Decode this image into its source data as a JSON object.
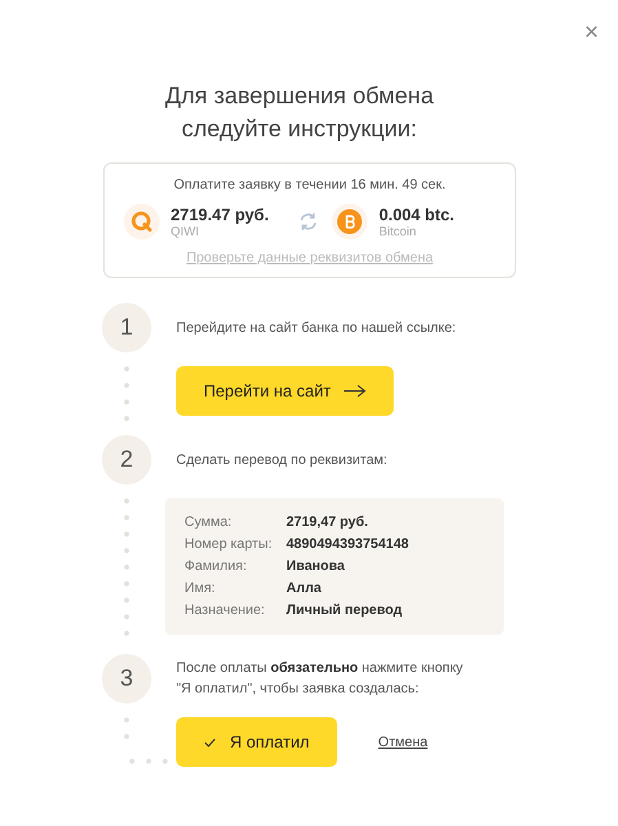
{
  "close": "×",
  "title": "Для завершения обмена\nследуйте инструкции:",
  "summary": {
    "timer": "Оплатите заявку в течении 16 мин. 49 сек.",
    "from": {
      "amount": "2719.47 руб.",
      "currency": "QIWI"
    },
    "to": {
      "amount": "0.004 btc.",
      "currency": "Bitcoin"
    },
    "link": "Проверьте данные реквизитов обмена"
  },
  "steps": [
    {
      "number": "1",
      "kind": "button",
      "text": "Перейдите на сайт банка по нашей ссылке:",
      "button": "Перейти на сайт"
    },
    {
      "number": "2",
      "kind": "details",
      "text": "Сделать перевод по реквизитам:",
      "details": [
        {
          "label": "Сумма:",
          "value": "2719,47 руб."
        },
        {
          "label": "Номер карты:",
          "value": "4890494393754148"
        },
        {
          "label": "Фамилия:",
          "value": "Иванова"
        },
        {
          "label": "Имя:",
          "value": "Алла"
        },
        {
          "label": "Назначение:",
          "value": "Личный перевод"
        }
      ]
    },
    {
      "number": "3",
      "kind": "confirm",
      "text": "После оплаты **обязательно** нажмите кнопку \"Я оплатил\", чтобы заявка создалась:",
      "button": "Я оплатил",
      "cancel": "Отмена"
    }
  ]
}
